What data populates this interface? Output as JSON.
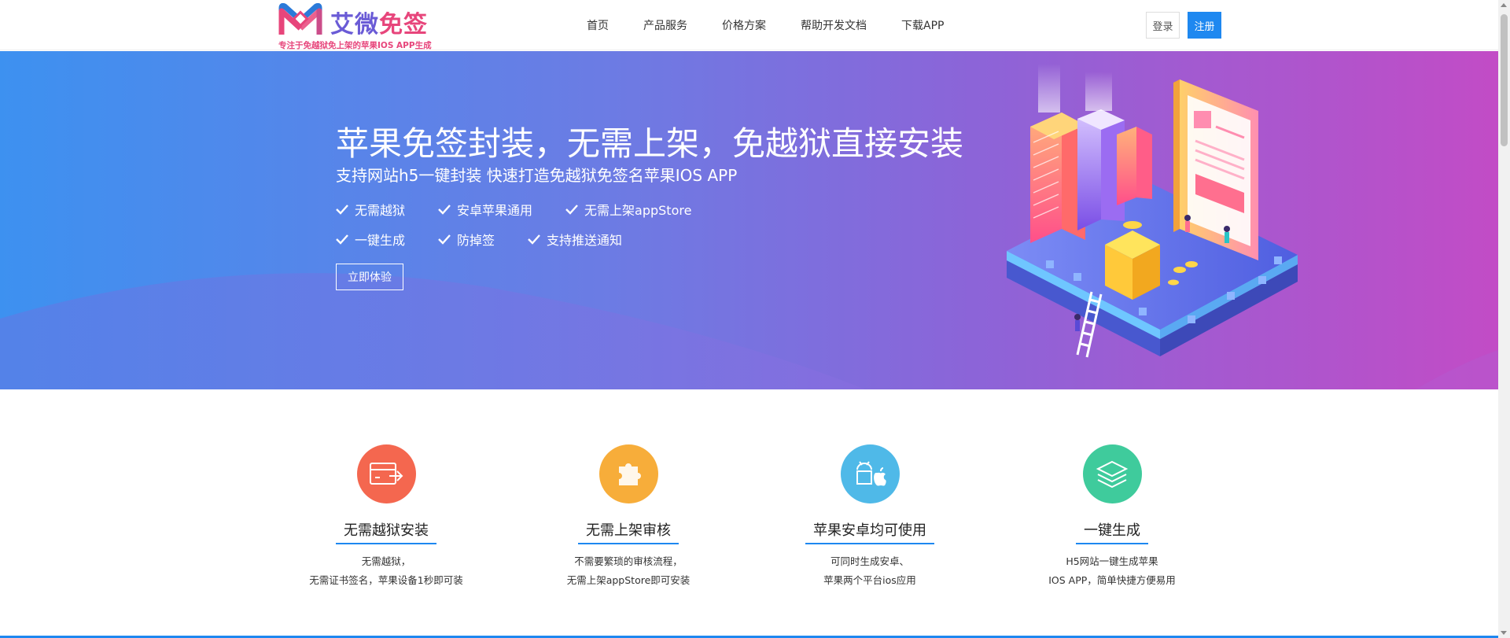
{
  "logo": {
    "name_left": "艾微",
    "name_right": "免签",
    "tagline": "专注于免越狱免上架的苹果IOS APP生成"
  },
  "nav": {
    "items": [
      "首页",
      "产品服务",
      "价格方案",
      "帮助开发文档",
      "下载APP"
    ]
  },
  "header": {
    "login_label": "登录",
    "register_label": "注册"
  },
  "hero": {
    "title": "苹果免签封装，无需上架，免越狱直接安装",
    "subtitle": "支持网站h5一键封装 快速打造免越狱免签名苹果IOS APP",
    "features_row1": [
      "无需越狱",
      "安卓苹果通用",
      "无需上架appStore"
    ],
    "features_row2": [
      "一键生成",
      "防掉签",
      "支持推送通知"
    ],
    "cta_label": "立即体验"
  },
  "cards": [
    {
      "title": "无需越狱安装",
      "line1": "无需越狱，",
      "line2": "无需证书签名，苹果设备1秒即可装",
      "color": "#f4674f",
      "icon": "card-swap-icon"
    },
    {
      "title": "无需上架审核",
      "line1": "不需要繁琐的审核流程，",
      "line2": "无需上架appStore即可安装",
      "color": "#f7ad3a",
      "icon": "puzzle-icon"
    },
    {
      "title": "苹果安卓均可使用",
      "line1": "可同时生成安卓、",
      "line2": "苹果两个平台ios应用",
      "color": "#4fb9e8",
      "icon": "android-apple-icon"
    },
    {
      "title": "一键生成",
      "line1": "H5网站一键生成苹果",
      "line2": "IOS APP，简单快捷方便易用",
      "color": "#3fcb9c",
      "icon": "layers-icon"
    }
  ]
}
